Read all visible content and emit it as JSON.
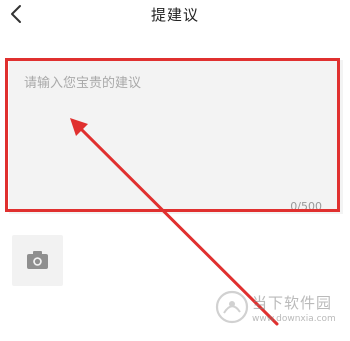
{
  "header": {
    "title": "提建议",
    "back_icon": "chevron-left-icon"
  },
  "feedback": {
    "value": "",
    "placeholder": "请输入您宝贵的建议",
    "counter": "0/500"
  },
  "upload": {
    "icon": "camera-icon"
  },
  "annotation": {
    "color": "#e0302f"
  },
  "watermark": {
    "text": "当下软件园",
    "url": "www.downxia.com"
  }
}
